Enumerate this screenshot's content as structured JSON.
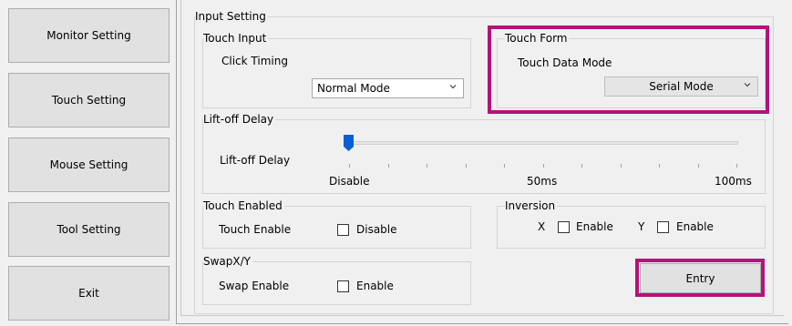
{
  "nav": {
    "monitor": "Monitor Setting",
    "touch": "Touch Setting",
    "mouse": "Mouse Setting",
    "tool": "Tool Setting",
    "exit": "Exit"
  },
  "input_setting": {
    "title": "Input Setting",
    "touch_input": {
      "title": "Touch Input",
      "click_timing_label": "Click Timing",
      "mode_value": "Normal Mode"
    },
    "touch_form": {
      "title": "Touch Form",
      "data_mode_label": "Touch Data Mode",
      "mode_value": "Serial Mode"
    }
  },
  "liftoff": {
    "title": "Lift-off Delay",
    "label": "Lift-off Delay",
    "min_label": "Disable",
    "mid_label": "50ms",
    "max_label": "100ms",
    "value_fraction": 0
  },
  "touch_enabled": {
    "title": "Touch Enabled",
    "label": "Touch Enable",
    "checkbox_label": "Disable"
  },
  "inversion": {
    "title": "Inversion",
    "x_label": "X",
    "x_checkbox_label": "Enable",
    "y_label": "Y",
    "y_checkbox_label": "Enable"
  },
  "swap": {
    "title": "SwapX/Y",
    "label": "Swap Enable",
    "checkbox_label": "Enable"
  },
  "entry_button": "Entry",
  "colors": {
    "highlight": "#b5127c",
    "slider_thumb": "#0a5fd6"
  }
}
